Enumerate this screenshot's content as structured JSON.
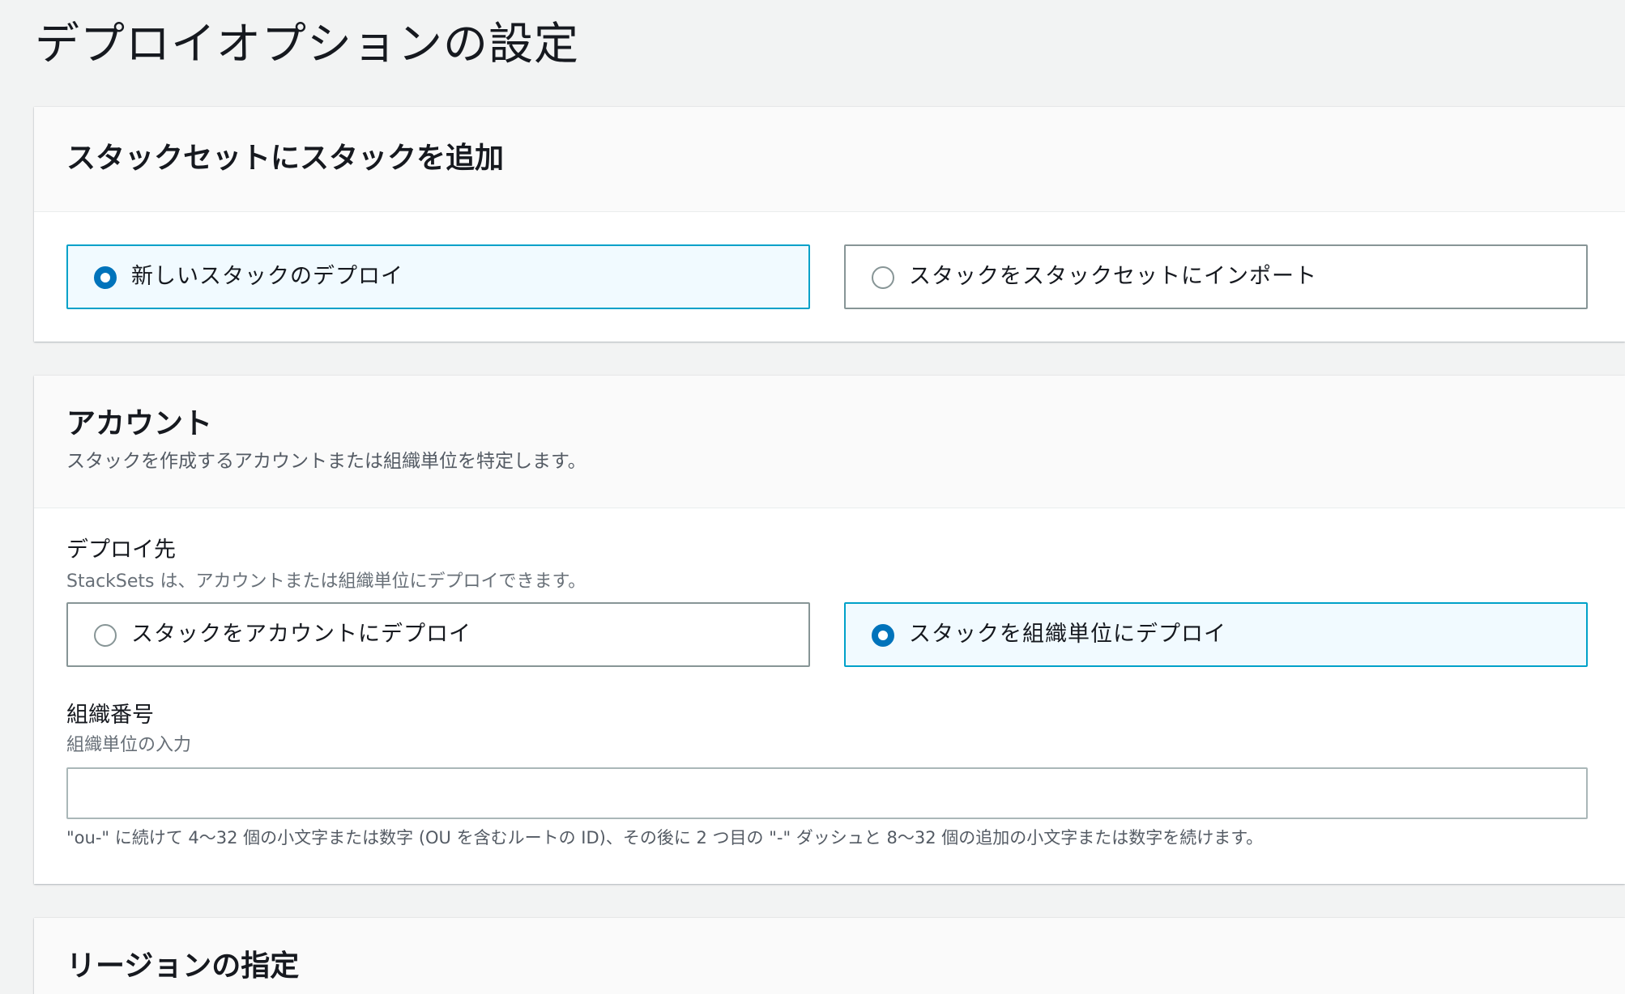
{
  "page": {
    "title": "デプロイオプションの設定"
  },
  "add_stacks": {
    "heading": "スタックセットにスタックを追加",
    "options": [
      {
        "label": "新しいスタックのデプロイ",
        "selected": true
      },
      {
        "label": "スタックをスタックセットにインポート",
        "selected": false
      }
    ]
  },
  "accounts": {
    "heading": "アカウント",
    "description": "スタックを作成するアカウントまたは組織単位を特定します。",
    "deploy_target": {
      "label": "デプロイ先",
      "description": "StackSets は、アカウントまたは組織単位にデプロイできます。",
      "options": [
        {
          "label": "スタックをアカウントにデプロイ",
          "selected": false
        },
        {
          "label": "スタックを組織単位にデプロイ",
          "selected": true
        }
      ]
    },
    "org_number": {
      "label": "組織番号",
      "description": "組織単位の入力",
      "value": "",
      "constraint": "\"ou-\" に続けて 4〜32 個の小文字または数字 (OU を含むルートの ID)、その後に 2 つ目の \"-\" ダッシュと 8〜32 個の追加の小文字または数字を続けます。"
    }
  },
  "regions": {
    "heading": "リージョンの指定"
  },
  "colors": {
    "accent": "#0073bb",
    "selected_border": "#00a1c9",
    "selected_bg": "#f1faff",
    "page_bg": "#f2f3f3"
  }
}
